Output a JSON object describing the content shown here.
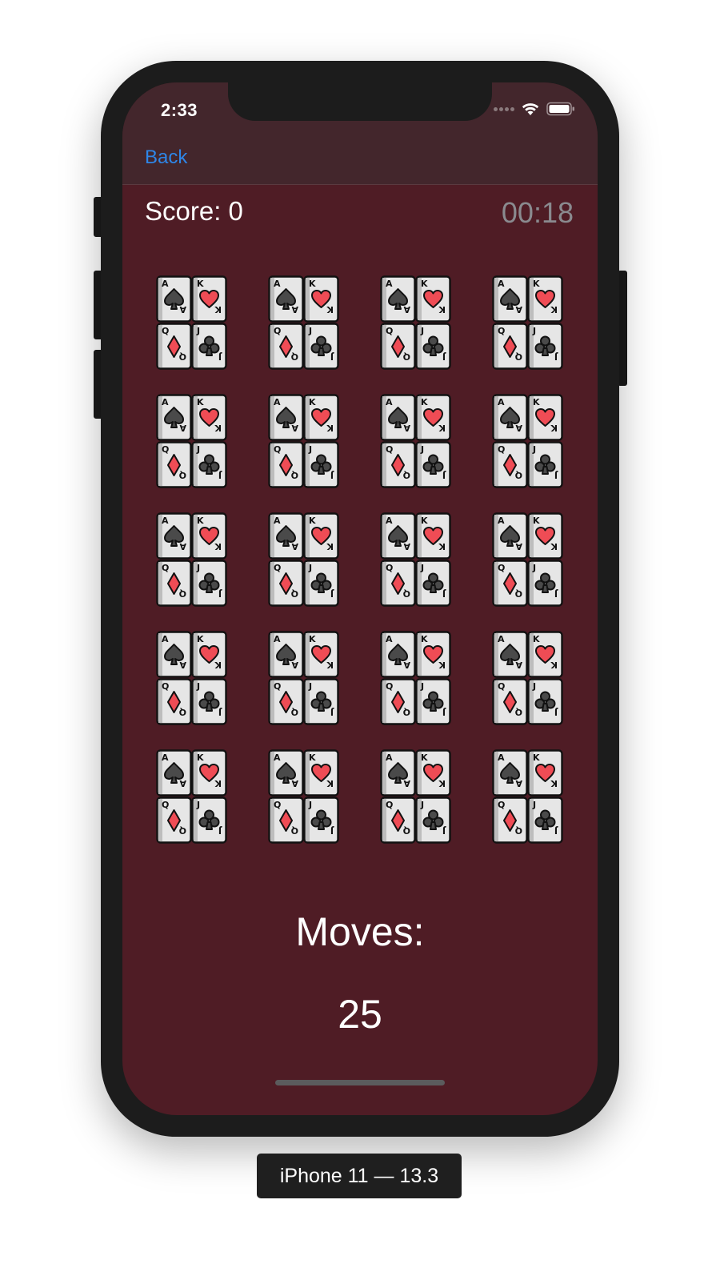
{
  "status_bar": {
    "time": "2:33",
    "icons": [
      "cellular-dots-icon",
      "wifi-icon",
      "battery-icon"
    ]
  },
  "nav": {
    "back_label": "Back"
  },
  "game": {
    "score_label": "Score: 0",
    "timer": "00:18",
    "card_icon": "playing-cards-icon",
    "card_count": 20,
    "moves_label": "Moves:",
    "moves_value": "25"
  },
  "device": {
    "label": "iPhone 11 — 13.3"
  },
  "colors": {
    "background": "#4f1c25",
    "nav_bar": "#43262c",
    "back_link": "#2e86e8",
    "timer": "#8a8a8f",
    "card_red": "#ef4c55",
    "card_face": "#e6e6e6"
  }
}
